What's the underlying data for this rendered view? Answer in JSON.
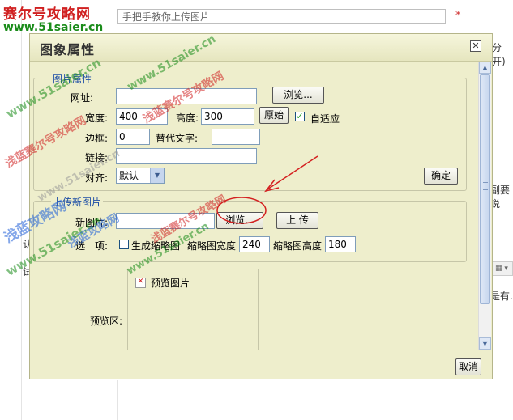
{
  "background": {
    "title_placeholder": "手把手教你上传图片",
    "required_mark": "*",
    "right_snippet_1": "分开)",
    "right_snippet_2": "副要说",
    "right_snippet_3": "是有.",
    "left_snippet_1": "认",
    "left_snippet_2": "试"
  },
  "dialog": {
    "title": "图象属性",
    "close_glyph": "☒",
    "image_props": {
      "legend": "图片属性",
      "url_label": "网址:",
      "url_value": "",
      "browse_label": "浏览...",
      "width_label": "宽度:",
      "width_value": "400",
      "height_label": "高度:",
      "height_value": "300",
      "original_label": "原始",
      "auto_fit_label": "自适应",
      "auto_fit_checked": true,
      "border_label": "边框:",
      "border_value": "0",
      "alt_label": "替代文字:",
      "alt_value": "",
      "link_label": "链接:",
      "link_value": "",
      "align_label": "对齐:",
      "align_value": "默认",
      "ok_label": "确定"
    },
    "upload": {
      "legend": "上传新图片",
      "new_image_label": "新图片:",
      "new_image_value": "",
      "browse_label": "浏览...",
      "upload_label": "上 传",
      "options_label": "选　项:",
      "thumb_label": "生成缩略图",
      "thumb_checked": false,
      "thumb_width_label": "缩略图宽度",
      "thumb_width_value": "240",
      "thumb_height_label": "缩略图高度",
      "thumb_height_value": "180"
    },
    "preview": {
      "label": "预览区:",
      "image_alt": "预览图片"
    },
    "cancel_label": "取消"
  },
  "watermark": {
    "site_name": "赛尔号攻略网",
    "site_url": "www.51saier.cn",
    "author": "浅蓝赛尔号攻略网",
    "author_short": "浅蓝攻略网"
  },
  "colors": {
    "dialog_bg": "#eeeecc",
    "legend_text": "#1f4fa6",
    "annotation_red": "#d42020",
    "watermark_green": "#1a8c1a",
    "watermark_blue": "#1e5fd8"
  }
}
